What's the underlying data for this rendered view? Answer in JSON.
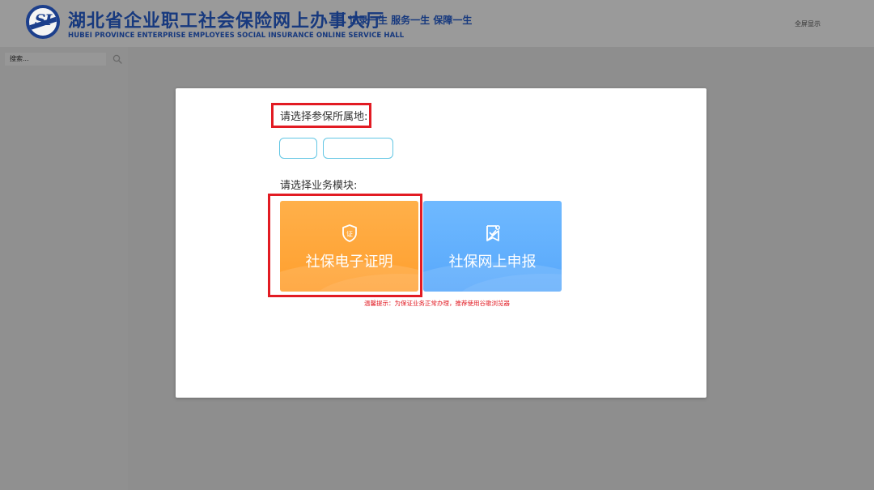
{
  "header": {
    "title": "湖北省企业职工社会保险网上办事大厅",
    "subtitle": "HUBEI PROVINCE ENTERPRISE EMPLOYEES SOCIAL INSURANCE ONLINE SERVICE HALL",
    "slogan": "记录一生  服务一生  保障一生",
    "fullscreen_label": "全屏显示",
    "logo_text": "SI",
    "brand_color": "#17397e"
  },
  "sidebar": {
    "search_placeholder": "搜索..."
  },
  "modal": {
    "region_label": "请选择参保所属地:",
    "region_province_value": "",
    "region_city_value": "",
    "module_label": "请选择业务模块:",
    "modules": [
      {
        "label": "社保电子证明",
        "icon": "certificate-shield-icon",
        "color": "#ffa83e"
      },
      {
        "label": "社保网上申报",
        "icon": "declaration-document-icon",
        "color": "#64b1fd"
      }
    ],
    "tip": "温馨提示：为保证业务正常办理，推荐使用谷歌浏览器",
    "highlight_color": "#e21b23"
  }
}
